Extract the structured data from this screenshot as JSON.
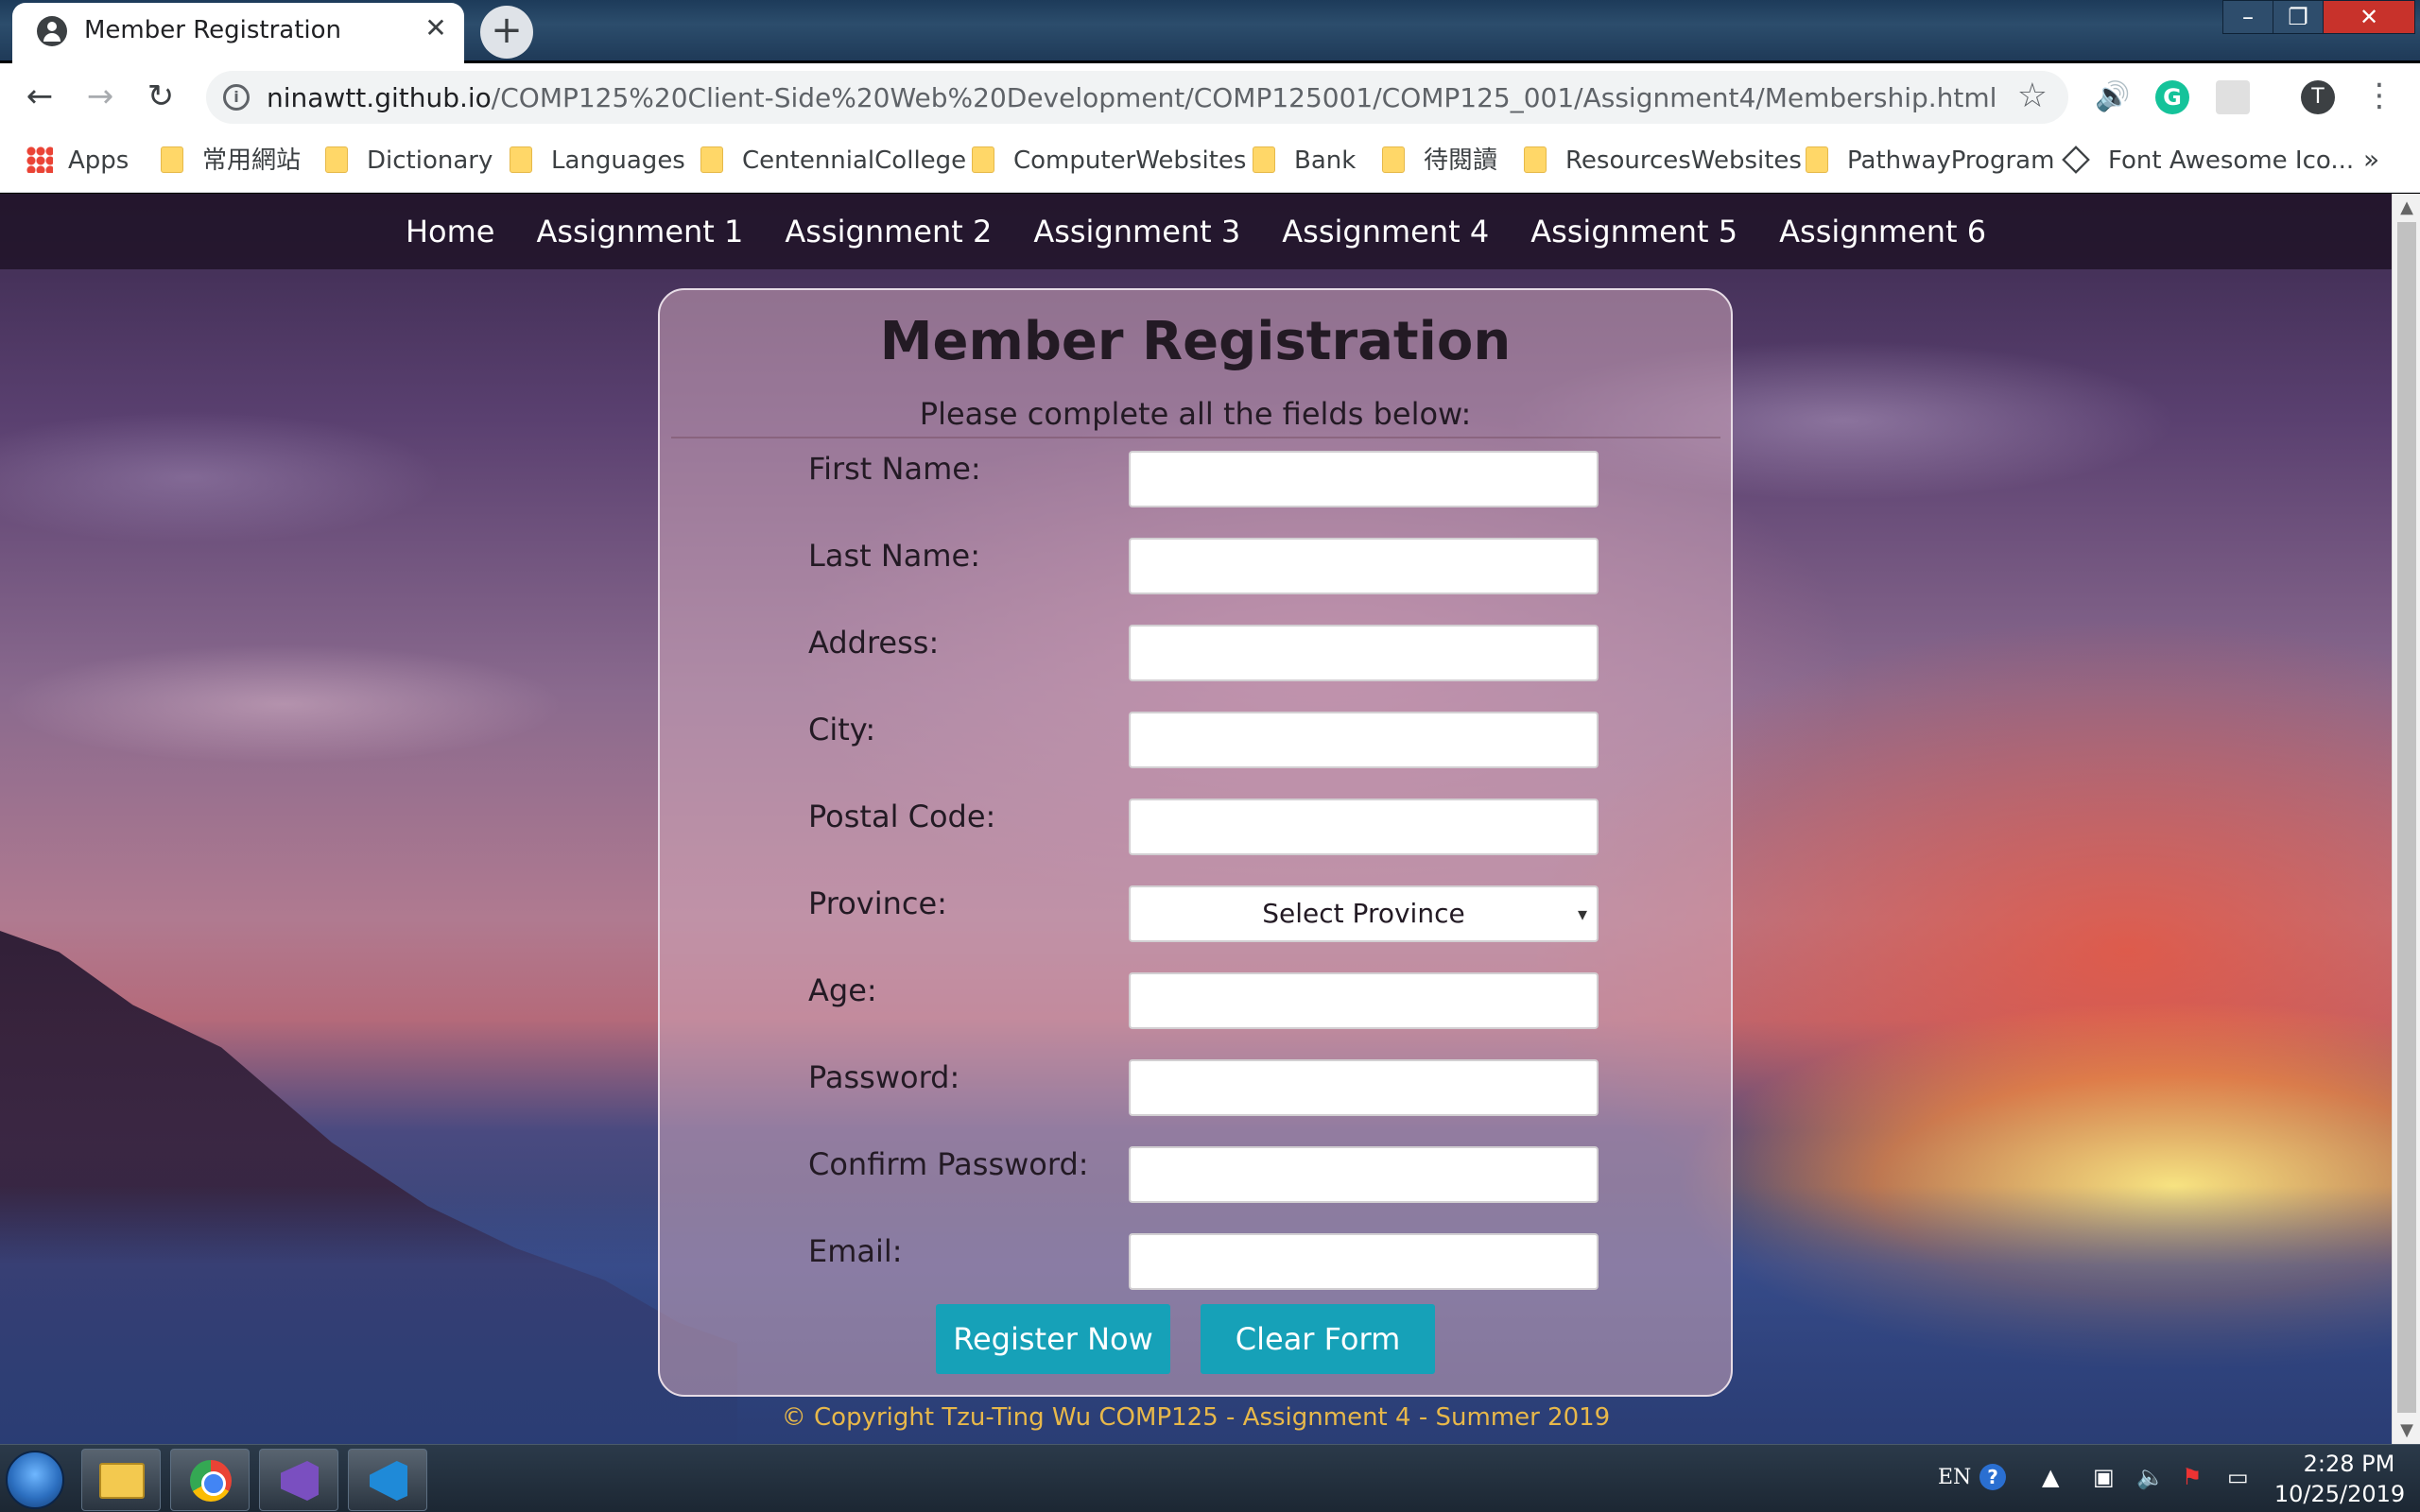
{
  "browser": {
    "tab": {
      "title": "Member Registration",
      "close_glyph": "✕",
      "new_tab_glyph": "+"
    },
    "window_controls": {
      "minimize": "–",
      "maximize": "❐",
      "close": "✕"
    },
    "nav": {
      "back": "←",
      "forward": "→",
      "reload": "↻"
    },
    "url": {
      "host": "ninawtt.github.io",
      "path": "/COMP125%20Client-Side%20Web%20Development/COMP125001/COMP125_001/Assignment4/Membership.html"
    },
    "info_glyph": "i",
    "star_glyph": "☆",
    "extensions": {
      "speaker": "🔊",
      "grammarly": "G",
      "puzzle": "",
      "profile_initial": "T",
      "menu": "⋮"
    },
    "bookmarks": [
      {
        "label": "Apps",
        "icon": "apps-grid-icon"
      },
      {
        "label": "常用網站",
        "icon": "folder-icon"
      },
      {
        "label": "Dictionary",
        "icon": "folder-icon"
      },
      {
        "label": "Languages",
        "icon": "folder-icon"
      },
      {
        "label": "CentennialCollege",
        "icon": "folder-icon"
      },
      {
        "label": "ComputerWebsites",
        "icon": "folder-icon"
      },
      {
        "label": "Bank",
        "icon": "folder-icon"
      },
      {
        "label": "待閱讀",
        "icon": "folder-icon"
      },
      {
        "label": "ResourcesWebsites",
        "icon": "folder-icon"
      },
      {
        "label": "PathwayProgram",
        "icon": "folder-icon"
      },
      {
        "label": "Font Awesome Ico...",
        "icon": "font-awesome-icon"
      }
    ],
    "bookmarks_more": "»"
  },
  "site_nav": [
    "Home",
    "Assignment 1",
    "Assignment 2",
    "Assignment 3",
    "Assignment 4",
    "Assignment 5",
    "Assignment 6"
  ],
  "form": {
    "title": "Member Registration",
    "subtitle": "Please complete all the fields below:",
    "fields": [
      {
        "label": "First Name:",
        "type": "text",
        "value": ""
      },
      {
        "label": "Last Name:",
        "type": "text",
        "value": ""
      },
      {
        "label": "Address:",
        "type": "text",
        "value": ""
      },
      {
        "label": "City:",
        "type": "text",
        "value": ""
      },
      {
        "label": "Postal Code:",
        "type": "text",
        "value": ""
      },
      {
        "label": "Province:",
        "type": "select",
        "value": "Select Province"
      },
      {
        "label": "Age:",
        "type": "text",
        "value": ""
      },
      {
        "label": "Password:",
        "type": "password",
        "value": ""
      },
      {
        "label": "Confirm Password:",
        "type": "password",
        "value": ""
      },
      {
        "label": "Email:",
        "type": "text",
        "value": ""
      }
    ],
    "select_caret": "▾",
    "register_label": "Register Now",
    "clear_label": "Clear Form",
    "button_color": "#16a1b8"
  },
  "footer": {
    "text": "© Copyright Tzu-Ting Wu COMP125 - Assignment 4 - Summer 2019",
    "color": "#e8b84a"
  },
  "scrollbar": {
    "up": "▲",
    "down": "▼"
  },
  "taskbar": {
    "language": "EN",
    "help_glyph": "?",
    "tray_arrow": "▲",
    "clock_time": "2:28 PM",
    "clock_date": "10/25/2019"
  }
}
